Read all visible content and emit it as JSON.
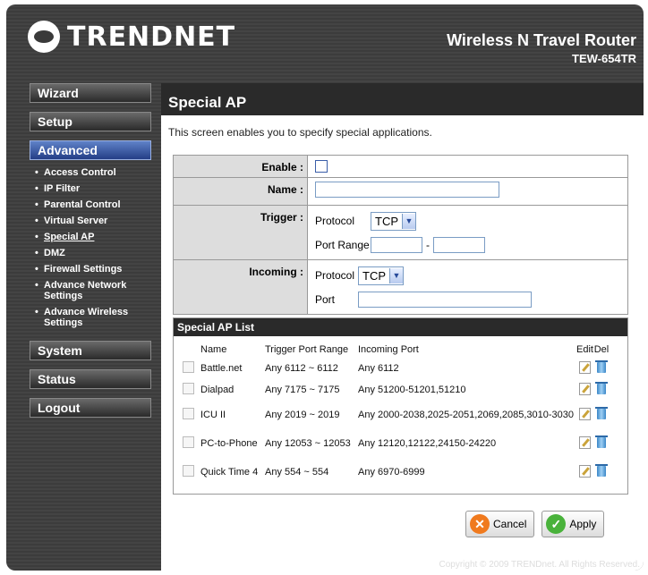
{
  "brand": {
    "logo_text": "TRENDNET",
    "product_name": "Wireless N Travel Router",
    "model": "TEW-654TR"
  },
  "sidebar": {
    "menu": [
      {
        "label": "Wizard"
      },
      {
        "label": "Setup"
      },
      {
        "label": "Advanced"
      },
      {
        "label": "System"
      },
      {
        "label": "Status"
      },
      {
        "label": "Logout"
      }
    ],
    "advanced_items": [
      {
        "label": "Access Control"
      },
      {
        "label": "IP Filter"
      },
      {
        "label": "Parental Control"
      },
      {
        "label": "Virtual Server"
      },
      {
        "label": "Special AP"
      },
      {
        "label": "DMZ"
      },
      {
        "label": "Firewall Settings"
      },
      {
        "label": "Advance Network Settings"
      },
      {
        "label": "Advance Wireless Settings"
      }
    ]
  },
  "page": {
    "title": "Special AP",
    "intro": "This screen enables you to specify special applications."
  },
  "form": {
    "enable_label": "Enable :",
    "name_label": "Name :",
    "name_value": "",
    "trigger_label": "Trigger :",
    "trigger_protocol_label": "Protocol",
    "trigger_protocol_value": "TCP",
    "trigger_port_range_label": "Port Range",
    "trigger_port_from": "",
    "trigger_port_sep": "-",
    "trigger_port_to": "",
    "incoming_label": "Incoming :",
    "incoming_protocol_label": "Protocol",
    "incoming_protocol_value": "TCP",
    "incoming_port_label": "Port",
    "incoming_port_value": ""
  },
  "list": {
    "title": "Special AP List",
    "headers": {
      "name": "Name",
      "trigger": "Trigger Port Range",
      "incoming": "Incoming Port",
      "edit": "Edit",
      "del": "Del"
    },
    "rows": [
      {
        "name": "Battle.net",
        "trigger": "Any 6112 ~ 6112",
        "incoming": "Any 6112"
      },
      {
        "name": "Dialpad",
        "trigger": "Any 7175 ~ 7175",
        "incoming": "Any 51200-51201,51210"
      },
      {
        "name": "ICU II",
        "trigger": "Any 2019 ~ 2019",
        "incoming": "Any 2000-2038,2025-2051,2069,2085,3010-3030"
      },
      {
        "name": "PC-to-Phone",
        "trigger": "Any 12053 ~ 12053",
        "incoming": "Any 12120,12122,24150-24220"
      },
      {
        "name": "Quick Time 4",
        "trigger": "Any 554 ~ 554",
        "incoming": "Any 6970-6999"
      }
    ]
  },
  "actions": {
    "cancel": "Cancel",
    "apply": "Apply"
  },
  "footer": {
    "copyright": "Copyright © 2009 TRENDnet. All Rights Reserved."
  },
  "colors": {
    "active_menu": "#3a5ea8",
    "cancel_icon": "#f07a1e",
    "apply_icon": "#49b23b"
  }
}
